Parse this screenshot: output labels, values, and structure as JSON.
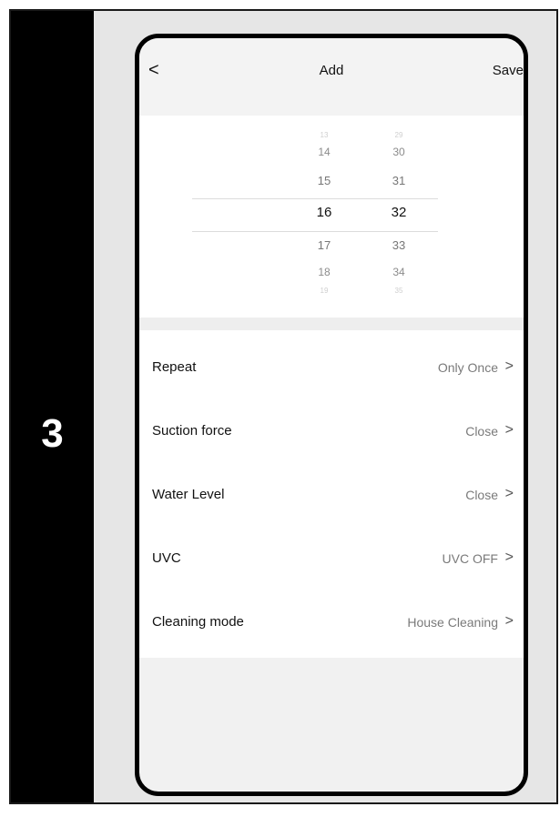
{
  "step": {
    "number": "3"
  },
  "nav": {
    "back_icon": "chevron-left-icon",
    "back_glyph": "<",
    "title": "Add",
    "save_label": "Save"
  },
  "picker": {
    "hours": {
      "faint_above": "13",
      "above2": "14",
      "above1": "15",
      "selected": "16",
      "below1": "17",
      "below2": "18",
      "faint_below": "19"
    },
    "minutes": {
      "faint_above": "29",
      "above2": "30",
      "above1": "31",
      "selected": "32",
      "below1": "33",
      "below2": "34",
      "faint_below": "35"
    }
  },
  "settings": {
    "rows": [
      {
        "label": "Repeat",
        "value": "Only Once",
        "chevron": ">"
      },
      {
        "label": "Suction force",
        "value": "Close",
        "chevron": ">"
      },
      {
        "label": "Water Level",
        "value": "Close",
        "chevron": ">"
      },
      {
        "label": "UVC",
        "value": "UVC OFF",
        "chevron": ">"
      },
      {
        "label": "Cleaning mode",
        "value": "House Cleaning",
        "chevron": ">"
      }
    ]
  }
}
